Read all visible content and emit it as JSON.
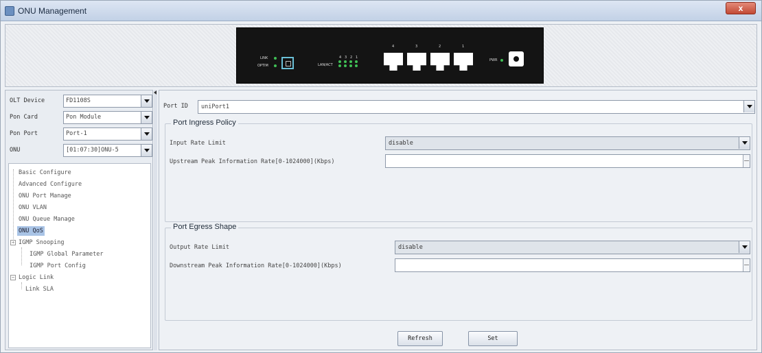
{
  "window": {
    "title": "ONU Management",
    "close_label": "x"
  },
  "device": {
    "pon_labels": [
      "LINK",
      "OPTIM"
    ],
    "lan_led_label": "LAN/ACT",
    "lan_led_numbers": [
      "4",
      "3",
      "2",
      "1"
    ],
    "port_numbers": [
      "4",
      "3",
      "2",
      "1"
    ],
    "power_label": "PWR"
  },
  "left": {
    "olt_label": "OLT Device",
    "olt_value": "FD1108S",
    "pon_card_label": "Pon Card",
    "pon_card_value": "Pon Module",
    "pon_port_label": "Pon Port",
    "pon_port_value": "Port-1",
    "onu_label": "ONU",
    "onu_value": "[01:07:30]ONU-5",
    "tree": [
      "Basic Configure",
      "Advanced Configure",
      "ONU Port Manage",
      "ONU VLAN",
      "ONU Queue Manage",
      "ONU QoS",
      "IGMP Snooping",
      "IGMP Global Parameter",
      "IGMP Port Config",
      "Logic Link",
      "Link SLA"
    ]
  },
  "right": {
    "port_label": "Port ID",
    "port_value": "uniPort1",
    "ingress": {
      "title": "Port Ingress Policy",
      "rate_label": "Input Rate Limit",
      "rate_value": "disable",
      "peak_label": "Upstream Peak Information Rate[0-1024000](Kbps)",
      "peak_value": ""
    },
    "egress": {
      "title": "Port Egress Shape",
      "rate_label": "Output Rate Limit",
      "rate_value": "disable",
      "peak_label": "Downstream Peak Information Rate[0-1024000](Kbps)",
      "peak_value": ""
    },
    "refresh_label": "Refresh",
    "set_label": "Set"
  }
}
